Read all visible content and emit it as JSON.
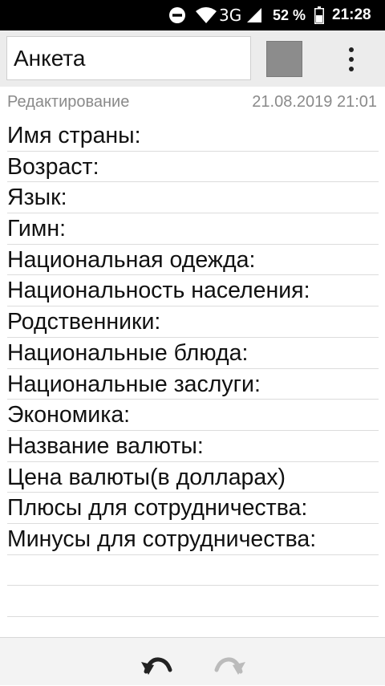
{
  "status_bar": {
    "network_type": "3G",
    "battery_percent": "52 %",
    "time": "21:28",
    "icons": [
      "do-not-disturb-icon",
      "wifi-icon",
      "signal-icon",
      "battery-icon"
    ]
  },
  "header": {
    "title_value": "Анкета",
    "color_swatch": "#8c8c8c",
    "menu_icon": "more-vert-icon"
  },
  "meta": {
    "mode": "Редактирование",
    "datetime": "21.08.2019 21:01"
  },
  "note": {
    "lines": [
      "Имя страны:",
      "Возраст:",
      "Язык:",
      "Гимн:",
      "Национальная одежда:",
      "Национальность населения:",
      "Родственники:",
      "Национальные блюда:",
      "Национальные заслуги:",
      "Экономика:",
      "Название валюты:",
      "Цена валюты(в долларах)",
      "Плюсы для сотрудничества:",
      "Минусы для сотрудничества:",
      "",
      "",
      ""
    ]
  },
  "toolbar": {
    "undo_icon": "undo-icon",
    "redo_icon": "redo-icon"
  }
}
